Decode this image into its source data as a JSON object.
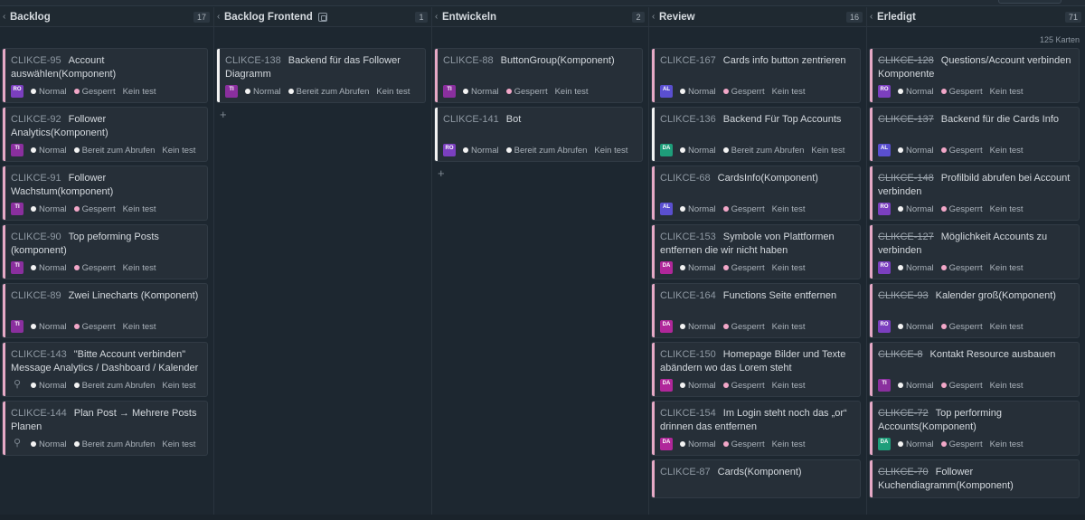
{
  "board": {
    "cards_count_label": "125 Karten",
    "colors": {
      "accent_pink": "#f2a7c8",
      "accent_white": "#f3f3f3",
      "background": "#1d2730"
    },
    "columns": [
      {
        "title": "Backlog",
        "count": "17",
        "has_icon": false,
        "cards": [
          {
            "id": "CLIKCE-95",
            "title": "Account auswählen(Komponent)",
            "avatar": "RO",
            "avatar_color": "#7b3fbf",
            "priority": "Normal",
            "status": "Gesperrt",
            "status_color": "pink",
            "test": "Kein test",
            "stripe": "pink",
            "strike": false
          },
          {
            "id": "CLIKCE-92",
            "title": "Follower Analytics(Komponent)",
            "avatar": "TI",
            "avatar_color": "#8a2f9e",
            "priority": "Normal",
            "status": "Bereit zum Abrufen",
            "status_color": "white",
            "test": "Kein test",
            "stripe": "pink",
            "strike": false
          },
          {
            "id": "CLIKCE-91",
            "title": "Follower Wachstum(komponent)",
            "avatar": "TI",
            "avatar_color": "#8a2f9e",
            "priority": "Normal",
            "status": "Gesperrt",
            "status_color": "pink",
            "test": "Kein test",
            "stripe": "pink",
            "strike": false
          },
          {
            "id": "CLIKCE-90",
            "title": "Top peforming Posts (komponent)",
            "avatar": "TI",
            "avatar_color": "#8a2f9e",
            "priority": "Normal",
            "status": "Gesperrt",
            "status_color": "pink",
            "test": "Kein test",
            "stripe": "pink",
            "strike": false
          },
          {
            "id": "CLIKCE-89",
            "title": "Zwei Linecharts (Komponent)",
            "avatar": "TI",
            "avatar_color": "#8a2f9e",
            "priority": "Normal",
            "status": "Gesperrt",
            "status_color": "pink",
            "test": "Kein test",
            "stripe": "pink",
            "strike": false
          },
          {
            "id": "CLIKCE-143",
            "title": "\"Bitte Account verbinden\" Message Analytics / Dashboard / Kalender",
            "avatar": "person",
            "avatar_color": "",
            "priority": "Normal",
            "status": "Bereit zum Abrufen",
            "status_color": "white",
            "test": "Kein test",
            "stripe": "pink",
            "strike": false
          },
          {
            "id": "CLIKCE-144",
            "title": "Plan Post → Mehrere Posts Planen",
            "avatar": "person",
            "avatar_color": "",
            "priority": "Normal",
            "status": "Bereit zum Abrufen",
            "status_color": "white",
            "test": "Kein test",
            "stripe": "pink",
            "strike": false
          }
        ]
      },
      {
        "title": "Backlog Frontend",
        "count": "1",
        "has_icon": true,
        "cards": [
          {
            "id": "CLIKCE-138",
            "title": "Backend für das Follower Diagramm",
            "avatar": "TI",
            "avatar_color": "#8a2f9e",
            "priority": "Normal",
            "status": "Bereit zum Abrufen",
            "status_color": "white",
            "test": "Kein test",
            "stripe": "white",
            "strike": false
          }
        ]
      },
      {
        "title": "Entwickeln",
        "count": "2",
        "has_icon": false,
        "cards": [
          {
            "id": "CLIKCE-88",
            "title": "ButtonGroup(Komponent)",
            "avatar": "TI",
            "avatar_color": "#8a2f9e",
            "priority": "Normal",
            "status": "Gesperrt",
            "status_color": "pink",
            "test": "Kein test",
            "stripe": "pink",
            "strike": false
          },
          {
            "id": "CLIKCE-141",
            "title": "Bot",
            "avatar": "RO",
            "avatar_color": "#7b3fbf",
            "priority": "Normal",
            "status": "Bereit zum Abrufen",
            "status_color": "white",
            "test": "Kein test",
            "stripe": "white",
            "strike": false
          }
        ]
      },
      {
        "title": "Review",
        "count": "16",
        "has_icon": false,
        "cards": [
          {
            "id": "CLIKCE-167",
            "title": "Cards info button zentrieren",
            "avatar": "AL",
            "avatar_color": "#5a4fcf",
            "priority": "Normal",
            "status": "Gesperrt",
            "status_color": "pink",
            "test": "Kein test",
            "stripe": "pink",
            "strike": false
          },
          {
            "id": "CLIKCE-136",
            "title": "Backend Für Top Accounts",
            "avatar": "DA",
            "avatar_color": "#1e9e7a",
            "priority": "Normal",
            "status": "Bereit zum Abrufen",
            "status_color": "white",
            "test": "Kein test",
            "stripe": "white",
            "strike": false
          },
          {
            "id": "CLIKCE-68",
            "title": "CardsInfo(Komponent)",
            "avatar": "AL",
            "avatar_color": "#5a4fcf",
            "priority": "Normal",
            "status": "Gesperrt",
            "status_color": "pink",
            "test": "Kein test",
            "stripe": "pink",
            "strike": false
          },
          {
            "id": "CLIKCE-153",
            "title": "Symbole von Plattformen entfernen die wir nicht haben",
            "avatar": "DA",
            "avatar_color": "#b0279a",
            "priority": "Normal",
            "status": "Gesperrt",
            "status_color": "pink",
            "test": "Kein test",
            "stripe": "pink",
            "strike": false
          },
          {
            "id": "CLIKCE-164",
            "title": "Functions Seite entfernen",
            "avatar": "DA",
            "avatar_color": "#b0279a",
            "priority": "Normal",
            "status": "Gesperrt",
            "status_color": "pink",
            "test": "Kein test",
            "stripe": "pink",
            "strike": false
          },
          {
            "id": "CLIKCE-150",
            "title": "Homepage Bilder und Texte abändern wo das Lorem steht",
            "avatar": "DA",
            "avatar_color": "#b0279a",
            "priority": "Normal",
            "status": "Gesperrt",
            "status_color": "pink",
            "test": "Kein test",
            "stripe": "pink",
            "strike": false
          },
          {
            "id": "CLIKCE-154",
            "title": "Im Login steht noch das „or“ drinnen das entfernen",
            "avatar": "DA",
            "avatar_color": "#b0279a",
            "priority": "Normal",
            "status": "Gesperrt",
            "status_color": "pink",
            "test": "Kein test",
            "stripe": "pink",
            "strike": false
          },
          {
            "id": "CLIKCE-87",
            "title": "Cards(Komponent)",
            "avatar": "",
            "avatar_color": "",
            "priority": "",
            "status": "",
            "status_color": "pink",
            "test": "",
            "stripe": "pink",
            "strike": false
          }
        ]
      },
      {
        "title": "Erledigt",
        "count": "71",
        "has_icon": false,
        "cards": [
          {
            "id": "CLIKCE-128",
            "title": "Questions/Account verbinden Komponente",
            "avatar": "RO",
            "avatar_color": "#7b3fbf",
            "priority": "Normal",
            "status": "Gesperrt",
            "status_color": "pink",
            "test": "Kein test",
            "stripe": "pink",
            "strike": true
          },
          {
            "id": "CLIKCE-137",
            "title": "Backend für die Cards Info",
            "avatar": "AL",
            "avatar_color": "#5a4fcf",
            "priority": "Normal",
            "status": "Gesperrt",
            "status_color": "pink",
            "test": "Kein test",
            "stripe": "pink",
            "strike": true
          },
          {
            "id": "CLIKCE-148",
            "title": "Profilbild abrufen bei Account verbinden",
            "avatar": "RO",
            "avatar_color": "#7b3fbf",
            "priority": "Normal",
            "status": "Gesperrt",
            "status_color": "pink",
            "test": "Kein test",
            "stripe": "pink",
            "strike": true
          },
          {
            "id": "CLIKCE-127",
            "title": "Möglichkeit Accounts zu verbinden",
            "avatar": "RO",
            "avatar_color": "#7b3fbf",
            "priority": "Normal",
            "status": "Gesperrt",
            "status_color": "pink",
            "test": "Kein test",
            "stripe": "pink",
            "strike": true
          },
          {
            "id": "CLIKCE-93",
            "title": "Kalender groß(Komponent)",
            "avatar": "RO",
            "avatar_color": "#7b3fbf",
            "priority": "Normal",
            "status": "Gesperrt",
            "status_color": "pink",
            "test": "Kein test",
            "stripe": "pink",
            "strike": true
          },
          {
            "id": "CLIKCE-8",
            "title": "Kontakt Resource ausbauen",
            "avatar": "TI",
            "avatar_color": "#8a2f9e",
            "priority": "Normal",
            "status": "Gesperrt",
            "status_color": "pink",
            "test": "Kein test",
            "stripe": "pink",
            "strike": true
          },
          {
            "id": "CLIKCE-72",
            "title": "Top performing Accounts(Komponent)",
            "avatar": "DA",
            "avatar_color": "#1e9e7a",
            "priority": "Normal",
            "status": "Gesperrt",
            "status_color": "pink",
            "test": "Kein test",
            "stripe": "pink",
            "strike": true
          },
          {
            "id": "CLIKCE-70",
            "title": "Follower Kuchendiagramm(Komponent)",
            "avatar": "",
            "avatar_color": "",
            "priority": "",
            "status": "",
            "status_color": "pink",
            "test": "",
            "stripe": "pink",
            "strike": true
          }
        ]
      }
    ]
  }
}
